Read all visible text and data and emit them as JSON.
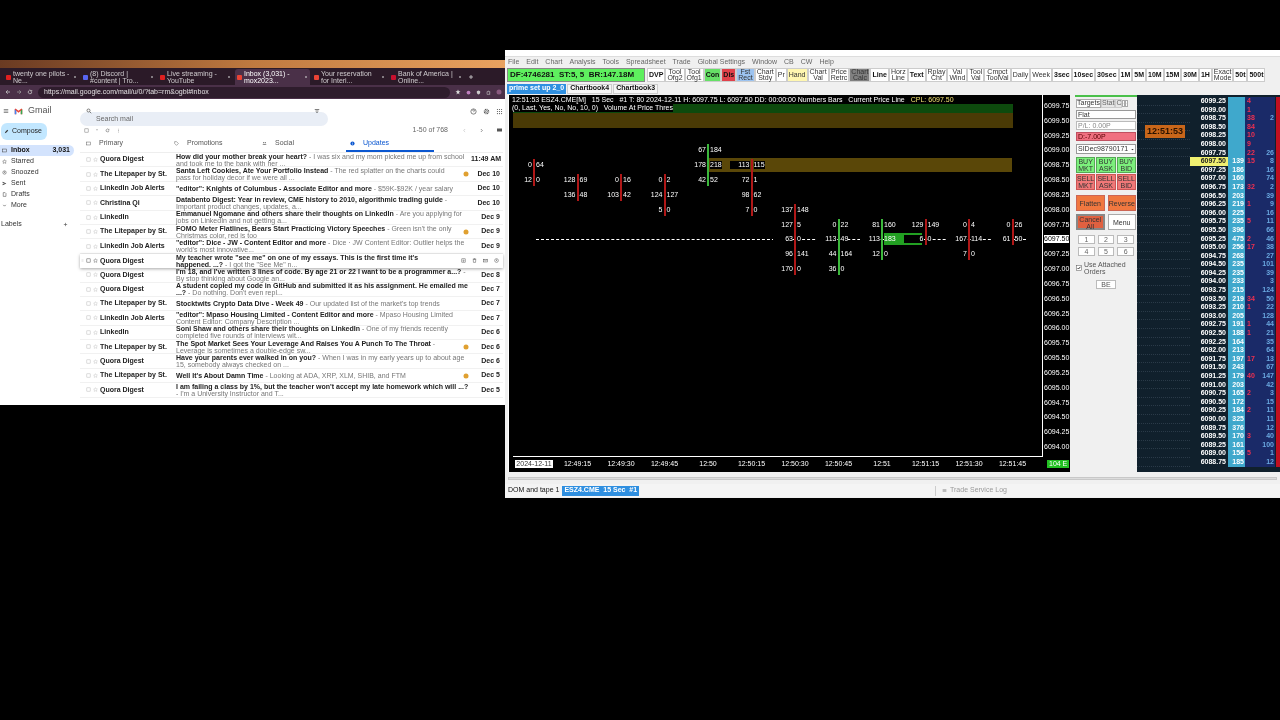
{
  "browser": {
    "tabs": [
      {
        "label": "twenty one pilots - Ne...",
        "selected": false,
        "color": "#e02020"
      },
      {
        "label": "(8) Discord | #content | Tro...",
        "selected": false,
        "color": "#5865f2"
      },
      {
        "label": "Live streaming - YouTube",
        "selected": false,
        "color": "#e02020"
      },
      {
        "label": "Inbox (3,031) - mox2023...",
        "selected": true,
        "color": "#ea4335"
      },
      {
        "label": "Your reservation for Interi...",
        "selected": false,
        "color": "#ea4335"
      },
      {
        "label": "Bank of America | Online...",
        "selected": false,
        "color": "#c8102e"
      }
    ],
    "url": "https://mail.google.com/mail/u/0/?tab=rm&ogbl#inbox"
  },
  "gmail": {
    "product": "Gmail",
    "search_placeholder": "Search mail",
    "compose": "Compose",
    "nav": [
      {
        "label": "Inbox",
        "count": "3,031",
        "selected": true
      },
      {
        "label": "Starred",
        "selected": false
      },
      {
        "label": "Snoozed",
        "selected": false
      },
      {
        "label": "Sent",
        "selected": false
      },
      {
        "label": "Drafts",
        "selected": false
      },
      {
        "label": "More",
        "selected": false
      }
    ],
    "labels_heading": "Labels",
    "page_range": "1-50 of 768",
    "categories": [
      {
        "label": "Primary",
        "selected": false
      },
      {
        "label": "Promotions",
        "selected": false
      },
      {
        "label": "Social",
        "selected": false
      },
      {
        "label": "Updates",
        "selected": true
      }
    ],
    "emails": [
      {
        "sender": "Quora Digest",
        "subject": "How did your mother break your heart?",
        "snippet": "- I was six and my mom picked me up from school and took me to the bank with her ...",
        "date": "11:49 AM",
        "has_icon": false,
        "hovered": false
      },
      {
        "sender": "The Litepaper by St.",
        "subject": "Santa Left Cookies, Ate Your Portfolio Instead",
        "snippet": "- The red splatter on the charts could pass for holiday decor if we were all ...",
        "date": "Dec 10",
        "has_icon": true,
        "hovered": false
      },
      {
        "sender": "LinkedIn Job Alerts",
        "subject": "\"editor\": Knights of Columbus - Associate Editor and more",
        "snippet": "- $59K-$92K / year salary",
        "date": "Dec 10",
        "has_icon": false,
        "hovered": false
      },
      {
        "sender": "Christina Qi",
        "subject": "Databento Digest: Year in review, CME history to 2010, algorithmic trading guide",
        "snippet": "- Important product changes, updates, a...",
        "date": "Dec 10",
        "has_icon": false,
        "hovered": false
      },
      {
        "sender": "LinkedIn",
        "subject": "Emmanuel Ngomane and others share their thoughts on LinkedIn",
        "snippet": "- Are you applying for jobs on LinkedIn and not getting a...",
        "date": "Dec 9",
        "has_icon": false,
        "hovered": false
      },
      {
        "sender": "The Litepaper by St.",
        "subject": "FOMO Meter Flatlines, Bears Start Practicing Victory Speeches",
        "snippet": "- Green isn't the only Christmas color, red is too",
        "date": "Dec 9",
        "has_icon": true,
        "hovered": false
      },
      {
        "sender": "LinkedIn Job Alerts",
        "subject": "\"editor\": Dice - JW - Content Editor and more",
        "snippet": "- Dice · JW Content Editor: Outlier helps the world's most innovative...",
        "date": "Dec 9",
        "has_icon": false,
        "hovered": false
      },
      {
        "sender": "Quora Digest",
        "subject": "My teacher wrote \"see me\" on one of my essays. This is the first time it's happened. ...?",
        "snippet": "- I got the \"See Me\" n...",
        "has_icon": false,
        "hovered": true
      },
      {
        "sender": "Quora Digest",
        "subject": "I'm 18, and I've written 3 lines of code. By age 21 or 22 I want to be a programmer a...?",
        "snippet": "- By stop thinking about Google an...",
        "date": "Dec 8",
        "has_icon": false,
        "hovered": false
      },
      {
        "sender": "Quora Digest",
        "subject": "A student copied my code in GitHub and submitted it as his assignment. He emailed me ...?",
        "snippet": "- Do nothing. Don't even repl...",
        "date": "Dec 7",
        "has_icon": false,
        "hovered": false
      },
      {
        "sender": "The Litepaper by St.",
        "subject": "Stocktwits Crypto Data Dive - Week 49",
        "snippet": "- Our updated list of the market's top trends",
        "date": "Dec 7",
        "has_icon": false,
        "hovered": false
      },
      {
        "sender": "LinkedIn Job Alerts",
        "subject": "\"editor\": Mpaso Housing Limited - Content Editor and more",
        "snippet": "- Mpaso Housing Limited Content Editor: Company Description ...",
        "date": "Dec 7",
        "has_icon": false,
        "hovered": false
      },
      {
        "sender": "LinkedIn",
        "subject": "Soni Shaw and others share their thoughts on LinkedIn",
        "snippet": "- One of my friends recently completed five rounds of interviews wit...",
        "date": "Dec 6",
        "has_icon": false,
        "hovered": false
      },
      {
        "sender": "The Litepaper by St.",
        "subject": "The Spot Market Sees Your Leverage And Raises You A Punch To The Throat",
        "snippet": "- Leverage is sometimes a double-edge sw...",
        "date": "Dec 6",
        "has_icon": true,
        "hovered": false
      },
      {
        "sender": "Quora Digest",
        "subject": "Have your parents ever walked in on you?",
        "snippet": "- When I was in my early years up to about age 15, somebody always checked on ...",
        "date": "Dec 6",
        "has_icon": false,
        "hovered": false
      },
      {
        "sender": "The Litepaper by St.",
        "subject": "Well It's About Damn Time",
        "snippet": "- Looking at ADA, XRP, XLM, SHIB, and FTM",
        "date": "Dec 5",
        "has_icon": true,
        "hovered": false
      },
      {
        "sender": "Quora Digest",
        "subject": "I am failing a class by 1%, but the teacher won't accept my late homework which will ...?",
        "snippet": "- I'm a University Instructor and T...",
        "date": "Dec 5",
        "has_icon": false,
        "hovered": false
      }
    ]
  },
  "sierra": {
    "menu": [
      "File",
      "Edit",
      "Chart",
      "Analysis",
      "Tools",
      "Spreadsheet",
      "Trade",
      "Global Settings",
      "Window",
      "CB",
      "CW",
      "Help"
    ],
    "status_field": "DF:4746281  ST:5, 5  BR:147.18M",
    "toolbar": [
      {
        "label": "DVP",
        "kind": "big"
      },
      {
        "label": "Tool Ofg2",
        "kind": "small"
      },
      {
        "label": "Tool Ofg1",
        "kind": "small"
      },
      {
        "label": "Con",
        "kind": "big",
        "color": "#66e066"
      },
      {
        "label": "Dis",
        "kind": "big",
        "color": "#e0404a"
      },
      {
        "label": "Fst Rect",
        "kind": "small",
        "color": "#9cc3f0"
      },
      {
        "label": "Chart Stdy",
        "kind": "small"
      },
      {
        "label": "Pr",
        "kind": "small"
      },
      {
        "label": "Hand",
        "kind": "small",
        "color": "#fff7b0"
      },
      {
        "label": "Chart Val",
        "kind": "small"
      },
      {
        "label": "Price Retrc",
        "kind": "small"
      },
      {
        "label": "Chart Calc",
        "kind": "small",
        "color": "#808080"
      },
      {
        "label": "Line",
        "kind": "big"
      },
      {
        "label": "Horz Line",
        "kind": "small"
      },
      {
        "label": "Text",
        "kind": "big"
      },
      {
        "label": "Rplay Cht",
        "kind": "small"
      },
      {
        "label": "Val Wind",
        "kind": "small"
      },
      {
        "label": "Tool Val",
        "kind": "small"
      },
      {
        "label": "Cmpct ToolVal",
        "kind": "small"
      },
      {
        "label": "Daily",
        "kind": "small"
      },
      {
        "label": "Week",
        "kind": "small"
      },
      {
        "label": "3sec",
        "kind": "big"
      },
      {
        "label": "10sec",
        "kind": "big"
      },
      {
        "label": "30sec",
        "kind": "big"
      },
      {
        "label": "1M",
        "kind": "big"
      },
      {
        "label": "5M",
        "kind": "big"
      },
      {
        "label": "10M",
        "kind": "big"
      },
      {
        "label": "15M",
        "kind": "big"
      },
      {
        "label": "30M",
        "kind": "big"
      },
      {
        "label": "1H",
        "kind": "big"
      },
      {
        "label": "Exact Mode",
        "kind": "small"
      },
      {
        "label": "50t",
        "kind": "big"
      },
      {
        "label": "500t",
        "kind": "big"
      }
    ],
    "chartbooks": [
      {
        "label": "prime set up 2_0",
        "selected": true
      },
      {
        "label": "Chartbook4",
        "selected": false
      },
      {
        "label": "Chartbook3",
        "selected": false
      }
    ],
    "chart": {
      "header": "12:51:53 ESZ4.CME[M]   15 Sec   #1 T: 80 2024-12-11 H: 6097.75 L: 6097.50 DD: 00:00:00 Numbers Bars   Current Price Line",
      "cpl": "CPL: 6097.50",
      "header_tail": "(0, Last, Yes, No, No, 10, 0)   Volume At Price Thres",
      "price_axis": [
        {
          "label": "6099.75",
          "current": false
        },
        {
          "label": "6099.50",
          "current": false
        },
        {
          "label": "6099.25",
          "current": false
        },
        {
          "label": "6099.00",
          "current": false
        },
        {
          "label": "6098.75",
          "current": false
        },
        {
          "label": "6098.50",
          "current": false
        },
        {
          "label": "6098.25",
          "current": false
        },
        {
          "label": "6098.00",
          "current": false
        },
        {
          "label": "6097.75",
          "current": false
        },
        {
          "label": "6097.50",
          "current": true
        },
        {
          "label": "6097.25",
          "current": false
        },
        {
          "label": "6097.00",
          "current": false
        },
        {
          "label": "6096.75",
          "current": false
        },
        {
          "label": "6096.50",
          "current": false
        },
        {
          "label": "6096.25",
          "current": false
        },
        {
          "label": "6096.00",
          "current": false
        },
        {
          "label": "6095.75",
          "current": false
        },
        {
          "label": "6095.50",
          "current": false
        },
        {
          "label": "6095.25",
          "current": false
        },
        {
          "label": "6095.00",
          "current": false
        },
        {
          "label": "6094.75",
          "current": false
        },
        {
          "label": "6094.50",
          "current": false
        },
        {
          "label": "6094.25",
          "current": false
        },
        {
          "label": "6094.00",
          "current": false
        }
      ],
      "time_axis": [
        {
          "label": "2024-12-11",
          "kind": "date"
        },
        {
          "label": "12:49:15",
          "kind": "time"
        },
        {
          "label": "12:49:30",
          "kind": "time"
        },
        {
          "label": "12:49:45",
          "kind": "time"
        },
        {
          "label": "12:50",
          "kind": "time"
        },
        {
          "label": "12:50:15",
          "kind": "time"
        },
        {
          "label": "12:50:30",
          "kind": "time"
        },
        {
          "label": "12:50:45",
          "kind": "time"
        },
        {
          "label": "12:51",
          "kind": "time"
        },
        {
          "label": "12:51:15",
          "kind": "time"
        },
        {
          "label": "12:51:30",
          "kind": "time"
        },
        {
          "label": "12:51:45",
          "kind": "time"
        }
      ],
      "bars": [
        {
          "kind": "down",
          "cells": [
            {
              "kind": "gap"
            },
            {
              "kind": "gap"
            },
            {
              "kind": "gap"
            },
            {
              "kind": "gap"
            },
            {
              "kind": "volume",
              "bid": "0",
              "ask": "64",
              "highlight": false
            },
            {
              "kind": "volume",
              "bid": "12",
              "ask": "0",
              "highlight": false
            }
          ]
        },
        {
          "kind": "down",
          "cells": [
            {
              "kind": "gap"
            },
            {
              "kind": "gap"
            },
            {
              "kind": "gap"
            },
            {
              "kind": "gap"
            },
            {
              "kind": "gap"
            },
            {
              "kind": "volume",
              "bid": "128",
              "ask": "69",
              "highlight": false
            },
            {
              "kind": "volume",
              "bid": "136",
              "ask": "48",
              "highlight": false
            }
          ]
        },
        {
          "kind": "down",
          "cells": [
            {
              "kind": "gap"
            },
            {
              "kind": "gap"
            },
            {
              "kind": "gap"
            },
            {
              "kind": "gap"
            },
            {
              "kind": "gap"
            },
            {
              "kind": "volume",
              "bid": "0",
              "ask": "16",
              "highlight": false
            },
            {
              "kind": "volume",
              "bid": "103",
              "ask": "42",
              "highlight": false
            }
          ]
        },
        {
          "kind": "down",
          "cells": [
            {
              "kind": "gap"
            },
            {
              "kind": "gap"
            },
            {
              "kind": "gap"
            },
            {
              "kind": "gap"
            },
            {
              "kind": "gap"
            },
            {
              "kind": "volume",
              "bid": "0",
              "ask": "2",
              "highlight": false
            },
            {
              "kind": "volume",
              "bid": "124",
              "ask": "127",
              "highlight": false
            },
            {
              "kind": "volume",
              "bid": "5",
              "ask": "0",
              "highlight": false
            }
          ]
        },
        {
          "kind": "up",
          "cells": [
            {
              "kind": "gap"
            },
            {
              "kind": "gap"
            },
            {
              "kind": "gap"
            },
            {
              "kind": "volume",
              "bid": "67",
              "ask": "184",
              "highlight": false
            },
            {
              "kind": "volume",
              "bid": "178",
              "ask": "218",
              "highlight": false
            },
            {
              "kind": "volume",
              "bid": "42",
              "ask": "52",
              "highlight": false
            }
          ]
        },
        {
          "kind": "down",
          "cells": [
            {
              "kind": "gap"
            },
            {
              "kind": "gap"
            },
            {
              "kind": "gap"
            },
            {
              "kind": "gap"
            },
            {
              "kind": "volume",
              "bid": "113",
              "ask": "115",
              "highlight": false
            },
            {
              "kind": "volume",
              "bid": "72",
              "ask": "1",
              "highlight": false
            },
            {
              "kind": "volume",
              "bid": "98",
              "ask": "62",
              "highlight": false
            },
            {
              "kind": "volume",
              "bid": "7",
              "ask": "0",
              "highlight": false
            }
          ]
        },
        {
          "kind": "down",
          "cells": [
            {
              "kind": "gap"
            },
            {
              "kind": "gap"
            },
            {
              "kind": "gap"
            },
            {
              "kind": "gap"
            },
            {
              "kind": "gap"
            },
            {
              "kind": "gap"
            },
            {
              "kind": "gap"
            },
            {
              "kind": "volume",
              "bid": "137",
              "ask": "148",
              "highlight": false
            },
            {
              "kind": "volume",
              "bid": "127",
              "ask": "5",
              "highlight": false
            },
            {
              "kind": "volume",
              "bid": "63",
              "ask": "0",
              "highlight": false
            },
            {
              "kind": "volume",
              "bid": "96",
              "ask": "141",
              "highlight": false
            },
            {
              "kind": "volume",
              "bid": "170",
              "ask": "0",
              "highlight": false
            }
          ]
        },
        {
          "kind": "up",
          "cells": [
            {
              "kind": "gap"
            },
            {
              "kind": "gap"
            },
            {
              "kind": "gap"
            },
            {
              "kind": "gap"
            },
            {
              "kind": "gap"
            },
            {
              "kind": "gap"
            },
            {
              "kind": "gap"
            },
            {
              "kind": "gap"
            },
            {
              "kind": "volume",
              "bid": "0",
              "ask": "22",
              "highlight": false
            },
            {
              "kind": "volume",
              "bid": "113",
              "ask": "49",
              "highlight": false
            },
            {
              "kind": "volume",
              "bid": "44",
              "ask": "164",
              "highlight": false
            },
            {
              "kind": "volume",
              "bid": "36",
              "ask": "0",
              "highlight": false
            }
          ]
        },
        {
          "kind": "up",
          "cells": [
            {
              "kind": "gap"
            },
            {
              "kind": "gap"
            },
            {
              "kind": "gap"
            },
            {
              "kind": "gap"
            },
            {
              "kind": "gap"
            },
            {
              "kind": "gap"
            },
            {
              "kind": "gap"
            },
            {
              "kind": "gap"
            },
            {
              "kind": "volume",
              "bid": "81",
              "ask": "160",
              "highlight": false
            },
            {
              "kind": "volume",
              "bid": "113",
              "ask": "183",
              "highlight": true
            },
            {
              "kind": "volume",
              "bid": "12",
              "ask": "0",
              "highlight": false
            }
          ]
        },
        {
          "kind": "down",
          "cells": [
            {
              "kind": "gap"
            },
            {
              "kind": "gap"
            },
            {
              "kind": "gap"
            },
            {
              "kind": "gap"
            },
            {
              "kind": "gap"
            },
            {
              "kind": "gap"
            },
            {
              "kind": "gap"
            },
            {
              "kind": "gap"
            },
            {
              "kind": "volume",
              "bid": "129",
              "ask": "149",
              "highlight": false
            },
            {
              "kind": "volume",
              "bid": "6",
              "ask": "0",
              "highlight": false
            }
          ]
        },
        {
          "kind": "down",
          "cells": [
            {
              "kind": "gap"
            },
            {
              "kind": "gap"
            },
            {
              "kind": "gap"
            },
            {
              "kind": "gap"
            },
            {
              "kind": "gap"
            },
            {
              "kind": "gap"
            },
            {
              "kind": "gap"
            },
            {
              "kind": "gap"
            },
            {
              "kind": "volume",
              "bid": "0",
              "ask": "4",
              "highlight": false
            },
            {
              "kind": "volume",
              "bid": "167",
              "ask": "114",
              "highlight": false
            },
            {
              "kind": "volume",
              "bid": "7",
              "ask": "0",
              "highlight": false
            }
          ]
        },
        {
          "kind": "down",
          "cells": [
            {
              "kind": "gap"
            },
            {
              "kind": "gap"
            },
            {
              "kind": "gap"
            },
            {
              "kind": "gap"
            },
            {
              "kind": "gap"
            },
            {
              "kind": "gap"
            },
            {
              "kind": "gap"
            },
            {
              "kind": "gap"
            },
            {
              "kind": "volume",
              "bid": "0",
              "ask": "26",
              "highlight": false
            },
            {
              "kind": "volume",
              "bid": "61",
              "ask": "50",
              "highlight": false
            }
          ]
        }
      ],
      "corner_badge": "104 E"
    },
    "order_panel": {
      "tabs": [
        {
          "label": "Targets",
          "selected": true
        },
        {
          "label": "Stat",
          "selected": false
        },
        {
          "label": "C",
          "selected": false
        }
      ],
      "position": "Flat",
      "pl": "P/L: 0.00P",
      "daily_pl": "D:-7.00P",
      "account": "SIDec98790171",
      "buttons": [
        {
          "label": "BUY MKT",
          "kind": "buy"
        },
        {
          "label": "BUY ASK",
          "kind": "buy"
        },
        {
          "label": "BUY BID",
          "kind": "buy"
        },
        {
          "label": "SELL MKT",
          "kind": "sell"
        },
        {
          "label": "SELL ASK",
          "kind": "sell"
        },
        {
          "label": "SELL BID",
          "kind": "sell"
        },
        {
          "label": "Flatten",
          "kind": "action"
        },
        {
          "label": "Reverse",
          "kind": "action"
        },
        {
          "label": "Cancel All",
          "kind": "cancel"
        },
        {
          "label": "Menu",
          "kind": "plain"
        }
      ],
      "quantity_keys": [
        "1",
        "2",
        "3",
        "4",
        "5",
        "6"
      ],
      "attached_orders": {
        "label": "Use Attached Orders",
        "checked": true
      },
      "be": "BE"
    },
    "clock": "12:51:53",
    "dom": [
      {
        "price": "6099.25",
        "trades": "4",
        "current": false
      },
      {
        "price": "6099.00",
        "trades": "1",
        "current": false
      },
      {
        "price": "6098.75",
        "trades": "38",
        "ask": "2",
        "current": false
      },
      {
        "price": "6098.50",
        "trades": "84",
        "current": false
      },
      {
        "price": "6098.25",
        "trades": "10",
        "current": false
      },
      {
        "price": "6098.00",
        "trades": "9",
        "current": false
      },
      {
        "price": "6097.75",
        "trades": "22",
        "ask": "26",
        "current": false
      },
      {
        "price": "6097.50",
        "bid": "139",
        "trades": "15",
        "ask": "8",
        "current": true
      },
      {
        "price": "6097.25",
        "bid": "186",
        "ask": "16",
        "current": false
      },
      {
        "price": "6097.00",
        "bid": "160",
        "ask": "74",
        "current": false
      },
      {
        "price": "6096.75",
        "bid": "173",
        "trades": "32",
        "ask": "2",
        "current": false
      },
      {
        "price": "6096.50",
        "bid": "203",
        "ask": "39",
        "current": false
      },
      {
        "price": "6096.25",
        "bid": "219",
        "trades": "1",
        "ask": "9",
        "current": false
      },
      {
        "price": "6096.00",
        "bid": "225",
        "ask": "16",
        "current": false
      },
      {
        "price": "6095.75",
        "bid": "235",
        "trades": "5",
        "ask": "11",
        "current": false
      },
      {
        "price": "6095.50",
        "bid": "396",
        "ask": "66",
        "current": false
      },
      {
        "price": "6095.25",
        "bid": "475",
        "trades": "2",
        "ask": "46",
        "current": false
      },
      {
        "price": "6095.00",
        "bid": "256",
        "trades": "17",
        "ask": "38",
        "current": false
      },
      {
        "price": "6094.75",
        "bid": "268",
        "ask": "27",
        "current": false
      },
      {
        "price": "6094.50",
        "bid": "235",
        "ask": "101",
        "current": false
      },
      {
        "price": "6094.25",
        "bid": "235",
        "ask": "39",
        "current": false
      },
      {
        "price": "6094.00",
        "bid": "233",
        "ask": "3",
        "current": false
      },
      {
        "price": "6093.75",
        "bid": "215",
        "ask": "124",
        "current": false
      },
      {
        "price": "6093.50",
        "bid": "219",
        "trades": "34",
        "ask": "50",
        "current": false
      },
      {
        "price": "6093.25",
        "bid": "210",
        "trades": "1",
        "ask": "22",
        "current": false
      },
      {
        "price": "6093.00",
        "bid": "205",
        "ask": "128",
        "current": false
      },
      {
        "price": "6092.75",
        "bid": "191",
        "trades": "1",
        "ask": "44",
        "current": false
      },
      {
        "price": "6092.50",
        "bid": "188",
        "trades": "1",
        "ask": "21",
        "current": false
      },
      {
        "price": "6092.25",
        "bid": "164",
        "ask": "35",
        "current": false
      },
      {
        "price": "6092.00",
        "bid": "213",
        "ask": "64",
        "current": false
      },
      {
        "price": "6091.75",
        "bid": "197",
        "trades": "17",
        "ask": "13",
        "current": false
      },
      {
        "price": "6091.50",
        "bid": "243",
        "ask": "67",
        "current": false
      },
      {
        "price": "6091.25",
        "bid": "179",
        "trades": "40",
        "ask": "147",
        "current": false
      },
      {
        "price": "6091.00",
        "bid": "203",
        "ask": "42",
        "current": false
      },
      {
        "price": "6090.75",
        "bid": "165",
        "trades": "2",
        "ask": "3",
        "current": false
      },
      {
        "price": "6090.50",
        "bid": "172",
        "ask": "15",
        "current": false
      },
      {
        "price": "6090.25",
        "bid": "184",
        "trades": "2",
        "ask": "11",
        "current": false
      },
      {
        "price": "6090.00",
        "bid": "325",
        "ask": "11",
        "current": false
      },
      {
        "price": "6089.75",
        "bid": "376",
        "ask": "12",
        "current": false
      },
      {
        "price": "6089.50",
        "bid": "170",
        "trades": "3",
        "ask": "40",
        "current": false
      },
      {
        "price": "6089.25",
        "bid": "161",
        "ask": "100",
        "current": false
      },
      {
        "price": "6089.00",
        "bid": "156",
        "trades": "5",
        "ask": "1",
        "current": false
      },
      {
        "price": "6088.75",
        "bid": "185",
        "ask": "12",
        "current": false
      }
    ],
    "bottom_tabs": [
      {
        "label": "DOM and tape 1",
        "selected": false
      },
      {
        "label": "ESZ4.CME  15 Sec  #1",
        "selected": true
      }
    ],
    "log_tab": "Trade Service Log"
  }
}
